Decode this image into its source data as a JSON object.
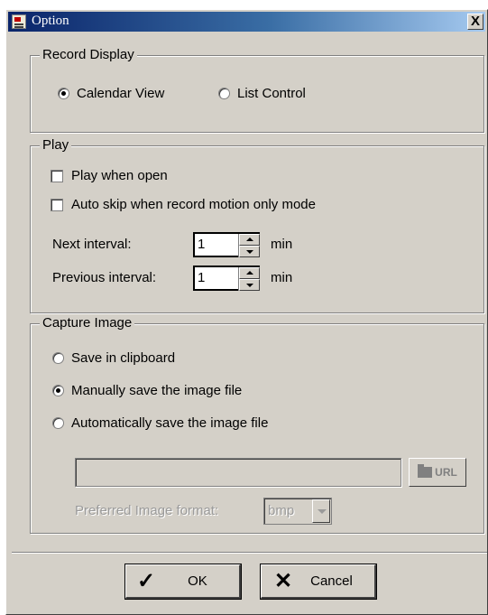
{
  "window": {
    "title": "Option",
    "close_label": "X"
  },
  "record_display": {
    "legend": "Record Display",
    "options": [
      {
        "label": "Calendar View",
        "selected": true
      },
      {
        "label": "List Control",
        "selected": false
      }
    ]
  },
  "play": {
    "legend": "Play",
    "play_when_open": {
      "label": "Play when open",
      "checked": false
    },
    "auto_skip": {
      "label": "Auto skip when record motion only mode",
      "checked": false
    },
    "next_interval": {
      "label": "Next interval:",
      "value": "1",
      "unit": "min"
    },
    "previous_interval": {
      "label": "Previous interval:",
      "value": "1",
      "unit": "min"
    }
  },
  "capture_image": {
    "legend": "Capture Image",
    "options": [
      {
        "label": "Save in clipboard",
        "selected": false
      },
      {
        "label": "Manually save the image file",
        "selected": true
      },
      {
        "label": "Automatically save the image file",
        "selected": false
      }
    ],
    "path_value": "",
    "url_button_label": "URL",
    "format_label": "Preferred Image format:",
    "format_value": "bmp"
  },
  "buttons": {
    "ok_label": "OK",
    "cancel_label": "Cancel"
  }
}
